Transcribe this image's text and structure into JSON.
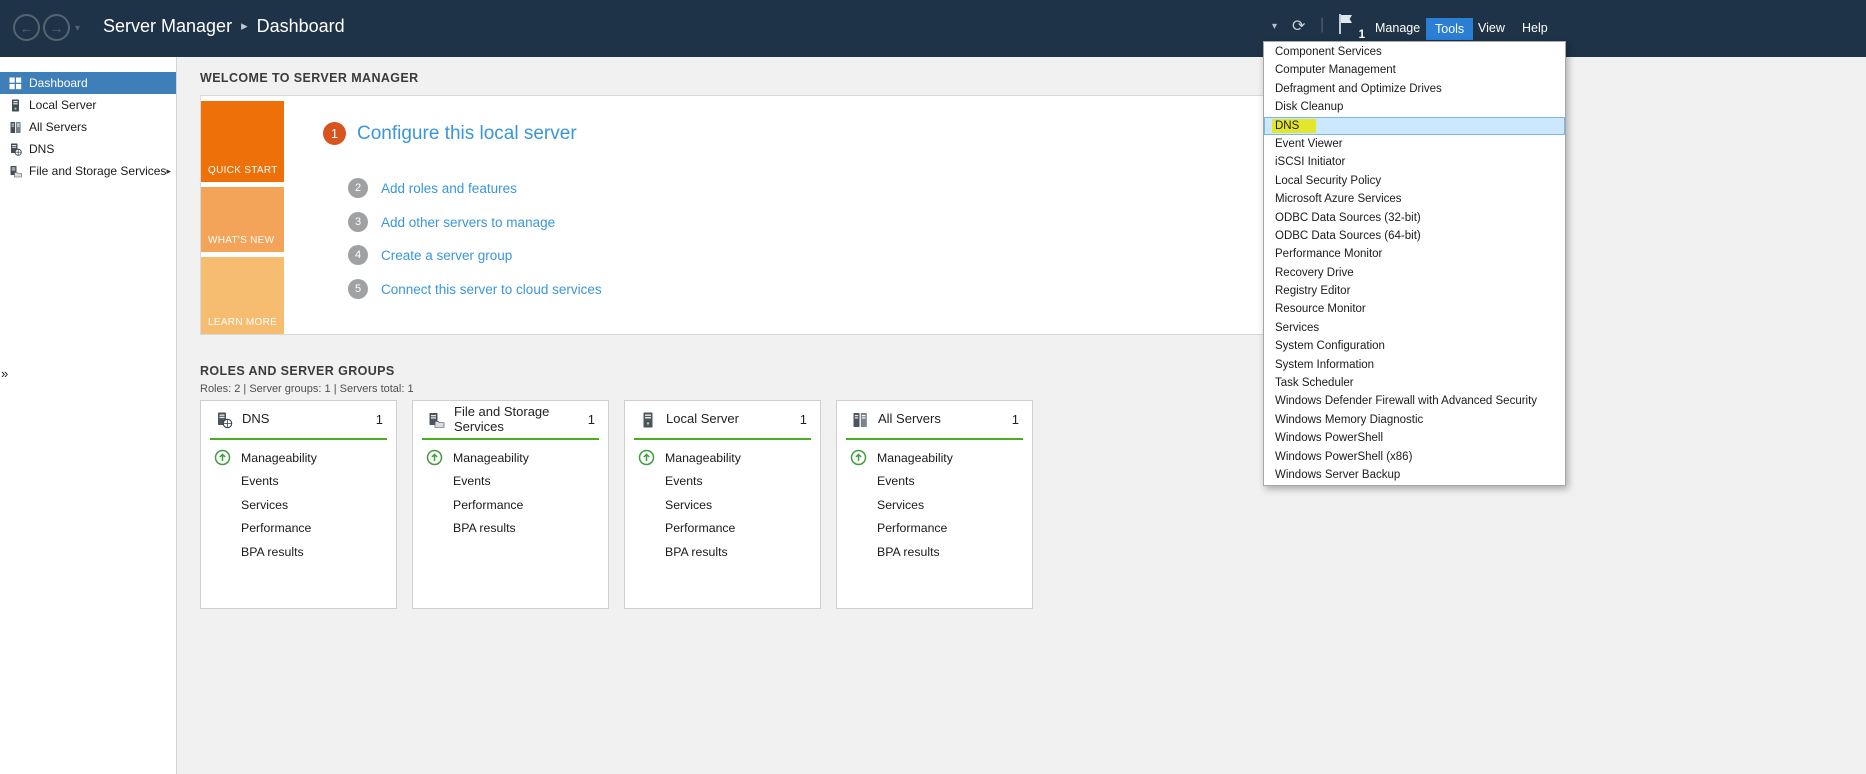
{
  "glyphs": {
    "back_arrow": "←",
    "forward_arrow": "→",
    "dropdown_caret": "▾",
    "refresh": "⟳",
    "divider": "|",
    "breadcrumb_separator": "▸",
    "sidebar_expand_arrow": "▸",
    "collapse_chevrons": "»"
  },
  "colors": {
    "topbar_bg": "#1e3348",
    "tools_active_bg": "#2a7fd4",
    "sidebar_selected_bg": "#3e7fba",
    "link_blue": "#3a96da",
    "accent_green": "#47af21",
    "manageability_green": "#3f9f3f",
    "quick_start_orange": "#ee7008",
    "whats_new_orange": "#f4a459",
    "learn_more_orange": "#f6bd70",
    "step1_circle_orange": "#d9531e",
    "menu_selected_bg": "#cce8ff",
    "highlight_yellow": "#e4e62c"
  },
  "topbar": {
    "app_title": "Server Manager",
    "page_title": "Dashboard",
    "notification_count": "1",
    "menu": {
      "manage": "Manage",
      "tools": "Tools",
      "view": "View",
      "help": "Help"
    }
  },
  "tools_menu": {
    "highlighted_item": "DNS",
    "items": [
      "Component Services",
      "Computer Management",
      "Defragment and Optimize Drives",
      "Disk Cleanup",
      "DNS",
      "Event Viewer",
      "iSCSI Initiator",
      "Local Security Policy",
      "Microsoft Azure Services",
      "ODBC Data Sources (32-bit)",
      "ODBC Data Sources (64-bit)",
      "Performance Monitor",
      "Recovery Drive",
      "Registry Editor",
      "Resource Monitor",
      "Services",
      "System Configuration",
      "System Information",
      "Task Scheduler",
      "Windows Defender Firewall with Advanced Security",
      "Windows Memory Diagnostic",
      "Windows PowerShell",
      "Windows PowerShell (x86)",
      "Windows Server Backup"
    ]
  },
  "sidebar": {
    "items": [
      {
        "label": "Dashboard"
      },
      {
        "label": "Local Server"
      },
      {
        "label": "All Servers"
      },
      {
        "label": "DNS"
      },
      {
        "label": "File and Storage Services"
      }
    ]
  },
  "welcome": {
    "heading": "WELCOME TO SERVER MANAGER",
    "blocks": [
      {
        "label": "QUICK START"
      },
      {
        "label": "WHAT'S NEW"
      },
      {
        "label": "LEARN MORE"
      }
    ],
    "steps": [
      {
        "num": "1",
        "label": "Configure this local server"
      },
      {
        "num": "2",
        "label": "Add roles and features"
      },
      {
        "num": "3",
        "label": "Add other servers to manage"
      },
      {
        "num": "4",
        "label": "Create a server group"
      },
      {
        "num": "5",
        "label": "Connect this server to cloud services"
      }
    ]
  },
  "roles": {
    "heading": "ROLES AND SERVER GROUPS",
    "summary": "Roles: 2 | Server groups: 1 | Servers total: 1",
    "tiles": [
      {
        "name": "DNS",
        "count": "1",
        "rows": [
          "Manageability",
          "Events",
          "Services",
          "Performance",
          "BPA results"
        ]
      },
      {
        "name": "File and Storage Services",
        "count": "1",
        "rows": [
          "Manageability",
          "Events",
          "Performance",
          "BPA results"
        ]
      },
      {
        "name": "Local Server",
        "count": "1",
        "rows": [
          "Manageability",
          "Events",
          "Services",
          "Performance",
          "BPA results"
        ]
      },
      {
        "name": "All Servers",
        "count": "1",
        "rows": [
          "Manageability",
          "Events",
          "Services",
          "Performance",
          "BPA results"
        ]
      }
    ]
  }
}
